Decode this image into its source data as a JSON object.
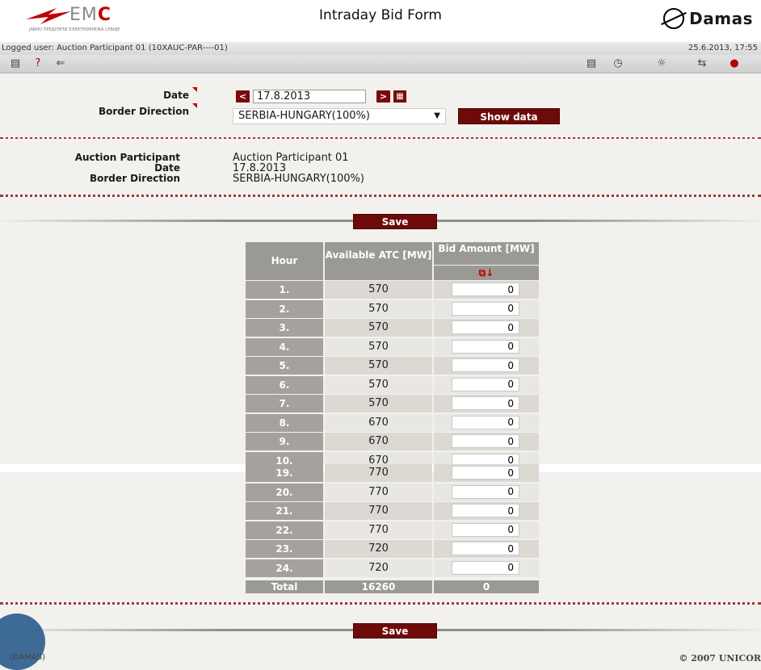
{
  "header": {
    "logo_left": {
      "emc_prefix": "EM",
      "emc_suffix": "C",
      "sub": "ЈАВНО ПРЕДУЗЕЋЕ ЕЛЕКТРОМРЕЖА СРБИЈЕ"
    },
    "title": "Intraday Bid Form",
    "logo_right": "Damas"
  },
  "userbar": {
    "logged_user": "Logged user: Auction Participant 01 (10XAUC-PAR----01)",
    "timestamp": "25.6.2013, 17:55"
  },
  "toolbar_icons": [
    "document-icon",
    "help-icon",
    "back-arrow-icon",
    "list-icon",
    "clock-icon",
    "new-sun-icon",
    "exchange-icon",
    "alert-doc-icon"
  ],
  "form": {
    "date_label": "Date",
    "date_value": "17.8.2013",
    "border_label": "Border Direction",
    "border_value": "SERBIA-HUNGARY(100%)",
    "show_data": "Show data"
  },
  "info": {
    "labels": [
      "Auction Participant",
      "Date",
      "Border Direction"
    ],
    "values": [
      "Auction Participant 01",
      "17.8.2013",
      "SERBIA-HUNGARY(100%)"
    ]
  },
  "save_label": "Save",
  "table": {
    "headers": {
      "hour": "Hour",
      "atc": "Available ATC [MW]",
      "bid": "Bid Amount [MW]"
    },
    "rows_top": [
      {
        "hour": "1.",
        "atc": "570",
        "bid": "0"
      },
      {
        "hour": "2.",
        "atc": "570",
        "bid": "0"
      },
      {
        "hour": "3.",
        "atc": "570",
        "bid": "0"
      },
      {
        "hour": "4.",
        "atc": "570",
        "bid": "0"
      },
      {
        "hour": "5.",
        "atc": "570",
        "bid": "0"
      },
      {
        "hour": "6.",
        "atc": "570",
        "bid": "0"
      },
      {
        "hour": "7.",
        "atc": "570",
        "bid": "0"
      },
      {
        "hour": "8.",
        "atc": "670",
        "bid": "0"
      },
      {
        "hour": "9.",
        "atc": "670",
        "bid": "0"
      },
      {
        "hour": "10.",
        "atc": "670",
        "bid": "0"
      }
    ],
    "rows_bottom": [
      {
        "hour": "19.",
        "atc": "770",
        "bid": "0"
      },
      {
        "hour": "20.",
        "atc": "770",
        "bid": "0"
      },
      {
        "hour": "21.",
        "atc": "770",
        "bid": "0"
      },
      {
        "hour": "22.",
        "atc": "770",
        "bid": "0"
      },
      {
        "hour": "23.",
        "atc": "720",
        "bid": "0"
      },
      {
        "hour": "24.",
        "atc": "720",
        "bid": "0"
      }
    ],
    "total": {
      "label": "Total",
      "atc": "16260",
      "bid": "0"
    }
  },
  "footer": {
    "left": "(DAMAS)",
    "right": "© 2007 UNICOR"
  }
}
